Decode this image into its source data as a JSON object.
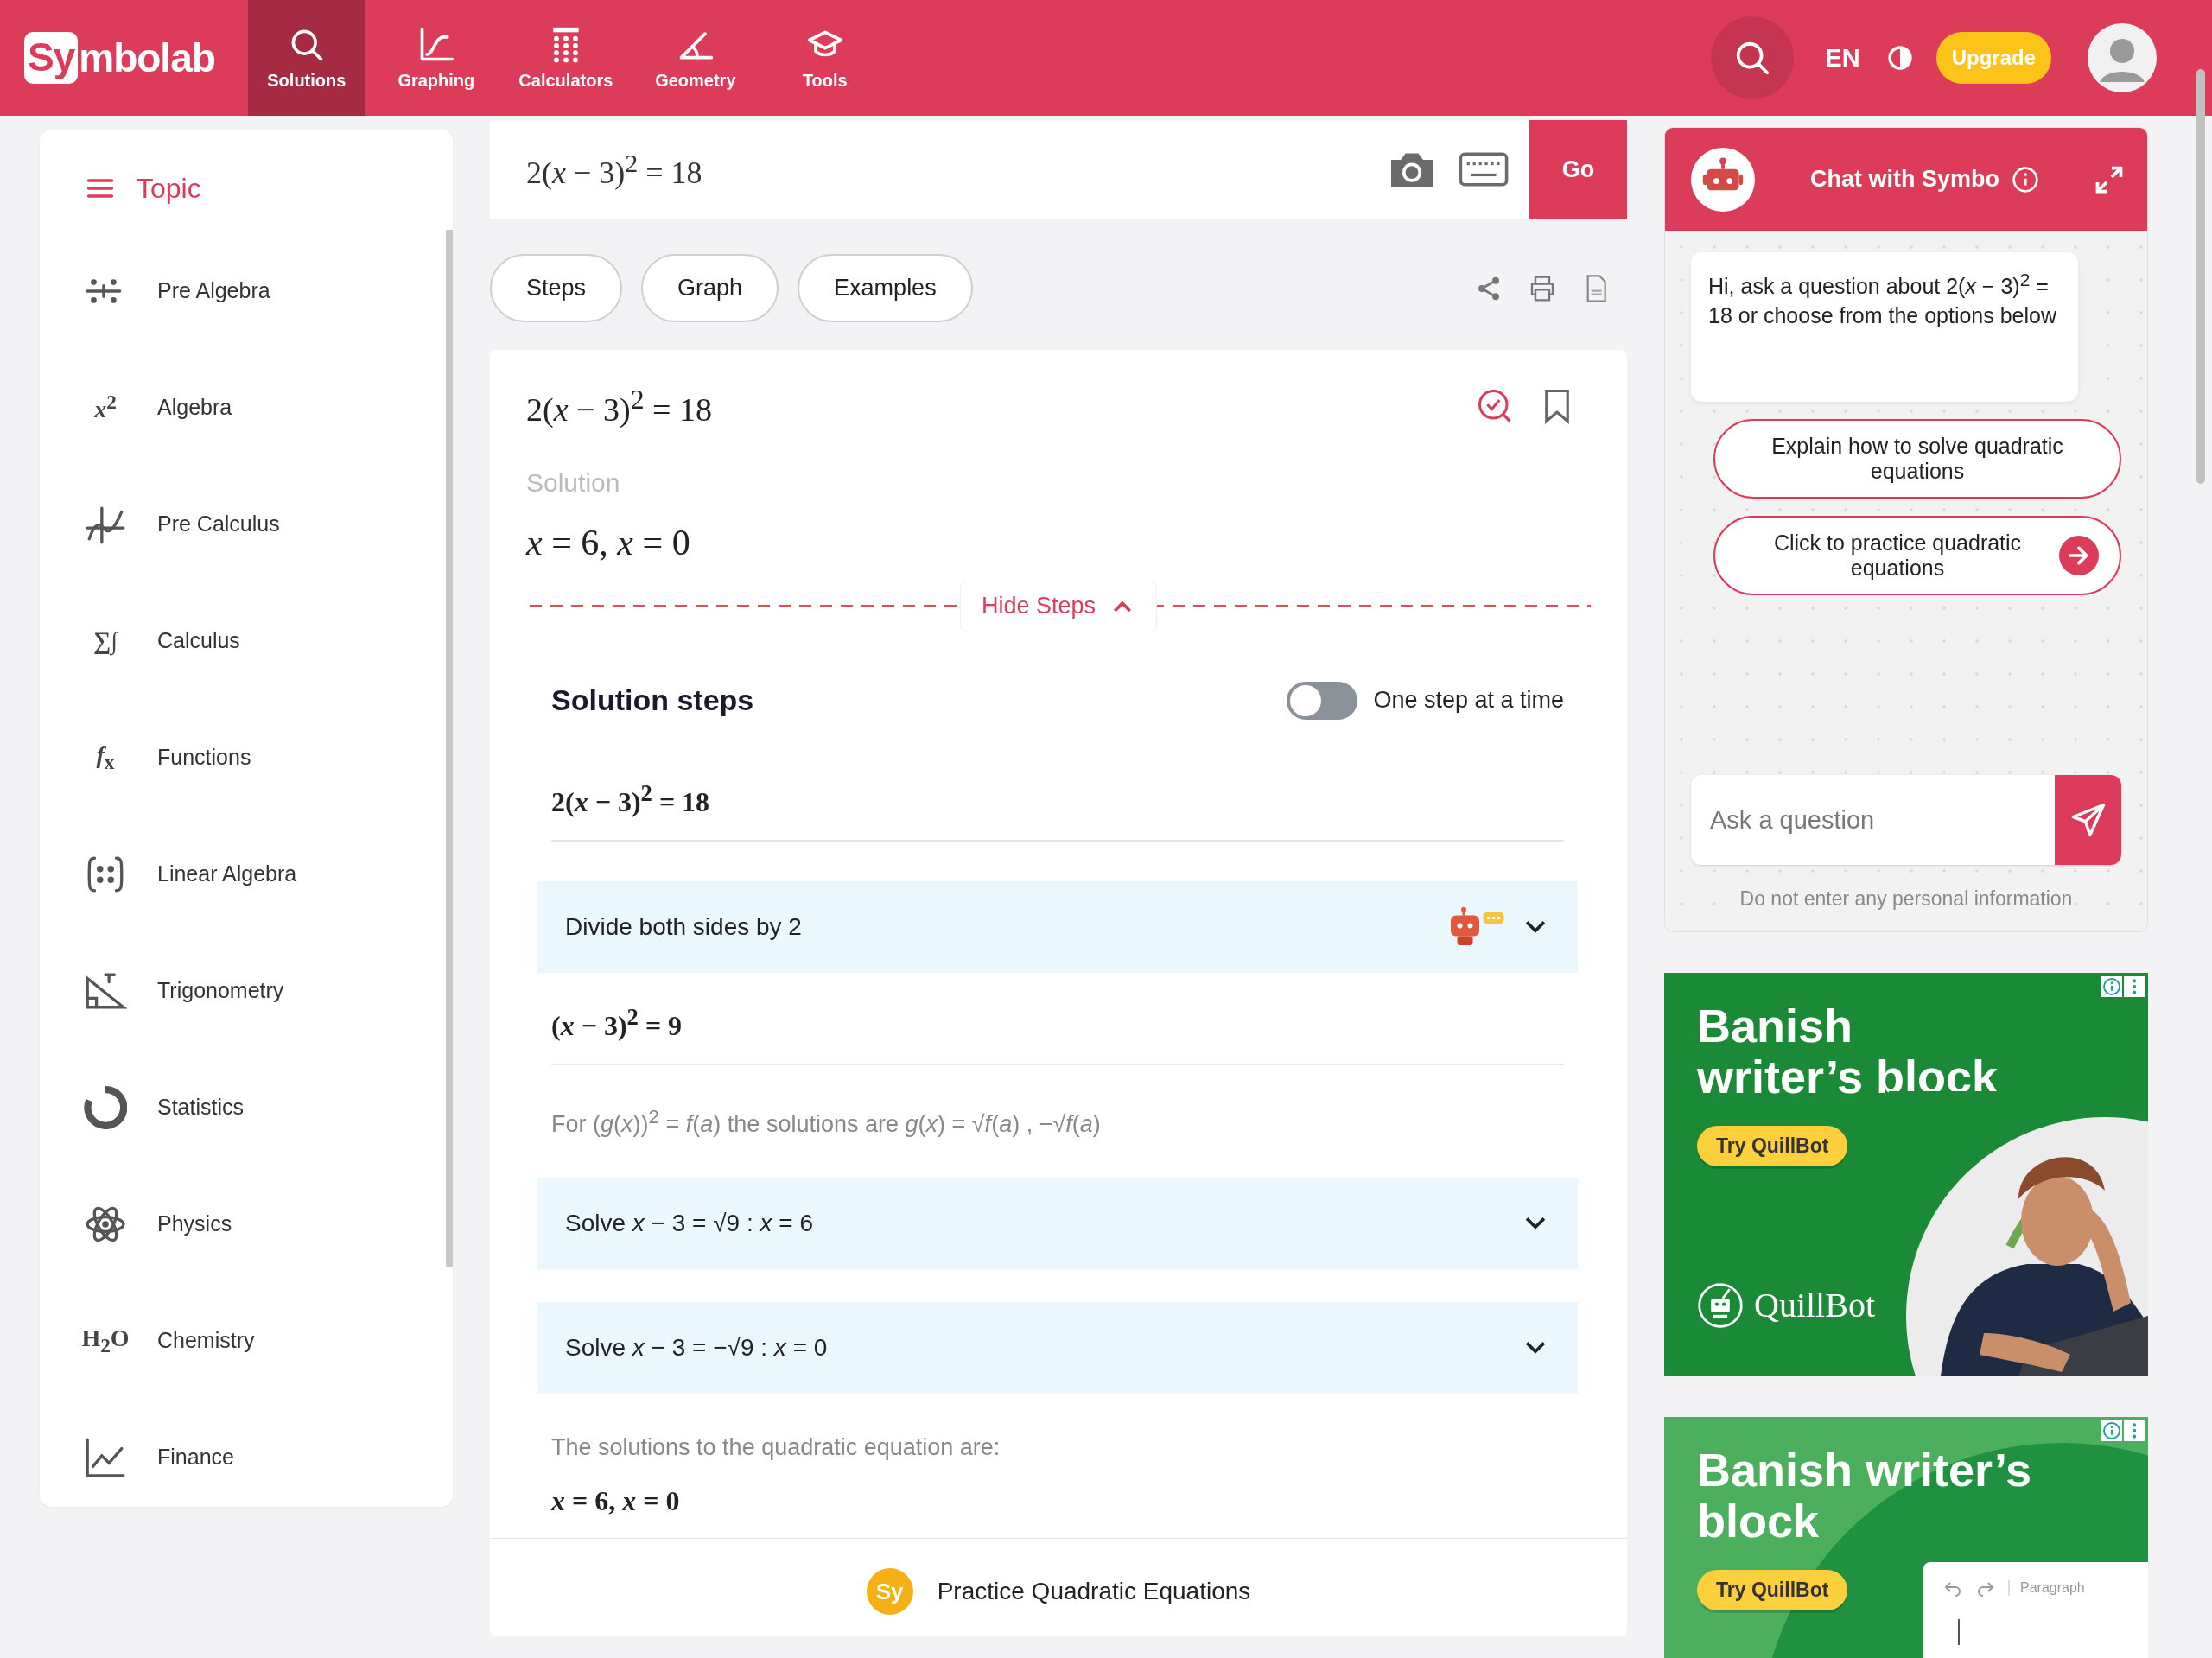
{
  "nav": {
    "logo": {
      "badge": "Sy",
      "text": "mbolab"
    },
    "items": [
      {
        "label": "Solutions",
        "selected": true
      },
      {
        "label": "Graphing",
        "selected": false
      },
      {
        "label": "Calculators",
        "selected": false
      },
      {
        "label": "Geometry",
        "selected": false
      },
      {
        "label": "Tools",
        "selected": false
      }
    ],
    "language": "EN",
    "upgrade": "Upgrade"
  },
  "sidebar": {
    "title": "Topic",
    "items": [
      {
        "label": "Pre Algebra"
      },
      {
        "label": "Algebra",
        "icon_text": "*x*$^{2}$"
      },
      {
        "label": "Pre Calculus"
      },
      {
        "label": "Calculus",
        "icon_text": "∑∫"
      },
      {
        "label": "Functions",
        "icon_text": "*f*$_{x}$"
      },
      {
        "label": "Linear Algebra"
      },
      {
        "label": "Trigonometry"
      },
      {
        "label": "Statistics"
      },
      {
        "label": "Physics"
      },
      {
        "label": "Chemistry",
        "icon_text": "H$_{2}$O"
      },
      {
        "label": "Finance"
      }
    ]
  },
  "problem": {
    "input": "2(*x* − 3)$^{2}$ = 18",
    "go": "Go"
  },
  "view_buttons": [
    "Steps",
    "Graph",
    "Examples"
  ],
  "result": {
    "equation": "2(*x* − 3)$^{2}$ = 18",
    "solution_label": "Solution",
    "solution": "*x* = 6, *x* = 0",
    "hide_steps": "Hide Steps"
  },
  "steps": {
    "title": "Solution steps",
    "toggle_label": "One step at a time",
    "toggle_on": false,
    "start": "2(*x* − 3)$^{2}$ = 18",
    "items": [
      {
        "kind": "expandable",
        "text": "Divide both sides by 2",
        "helper": true,
        "expanded": false
      },
      {
        "kind": "result",
        "text": "(*x* − 3)$^{2}$ = 9"
      },
      {
        "kind": "note",
        "text": "For (*g*(*x*))$^{2}$ = *f*(*a*) the solutions are *g*(*x*) = √*f*(*a*) ,  −√*f*(*a*)"
      },
      {
        "kind": "expandable",
        "text": "Solve *x* − 3 = √9 :   *x* = 6",
        "helper": false,
        "expanded": false
      },
      {
        "kind": "expandable",
        "text": "Solve *x* − 3 = −√9 :   *x* = 0",
        "helper": false,
        "expanded": false
      },
      {
        "kind": "note",
        "text": "The solutions to the quadratic equation are:"
      },
      {
        "kind": "result",
        "text": "*x* = 6, *x* = 0"
      }
    ]
  },
  "practice": {
    "badge": "Sy",
    "label": "Practice Quadratic Equations"
  },
  "chat": {
    "title": "Chat with Symbo",
    "message": "Hi, ask a question about 2(*x* − 3)$^{2}$ = 18 or choose from the options below",
    "options": [
      {
        "kind": "plain",
        "label": "Explain how to solve quadratic equations"
      },
      {
        "kind": "arrow",
        "label": "Click to practice quadratic equations"
      }
    ],
    "placeholder": "Ask a question",
    "disclaimer": "Do not enter any personal information"
  },
  "ads": [
    {
      "headline": "Banish writer’s block",
      "cta": "Try QuillBot",
      "brand": "QuillBot"
    },
    {
      "kind": "editor",
      "headline": "Banish writer’s block",
      "cta": "Try QuillBot",
      "editor_label": "Paragraph"
    }
  ]
}
